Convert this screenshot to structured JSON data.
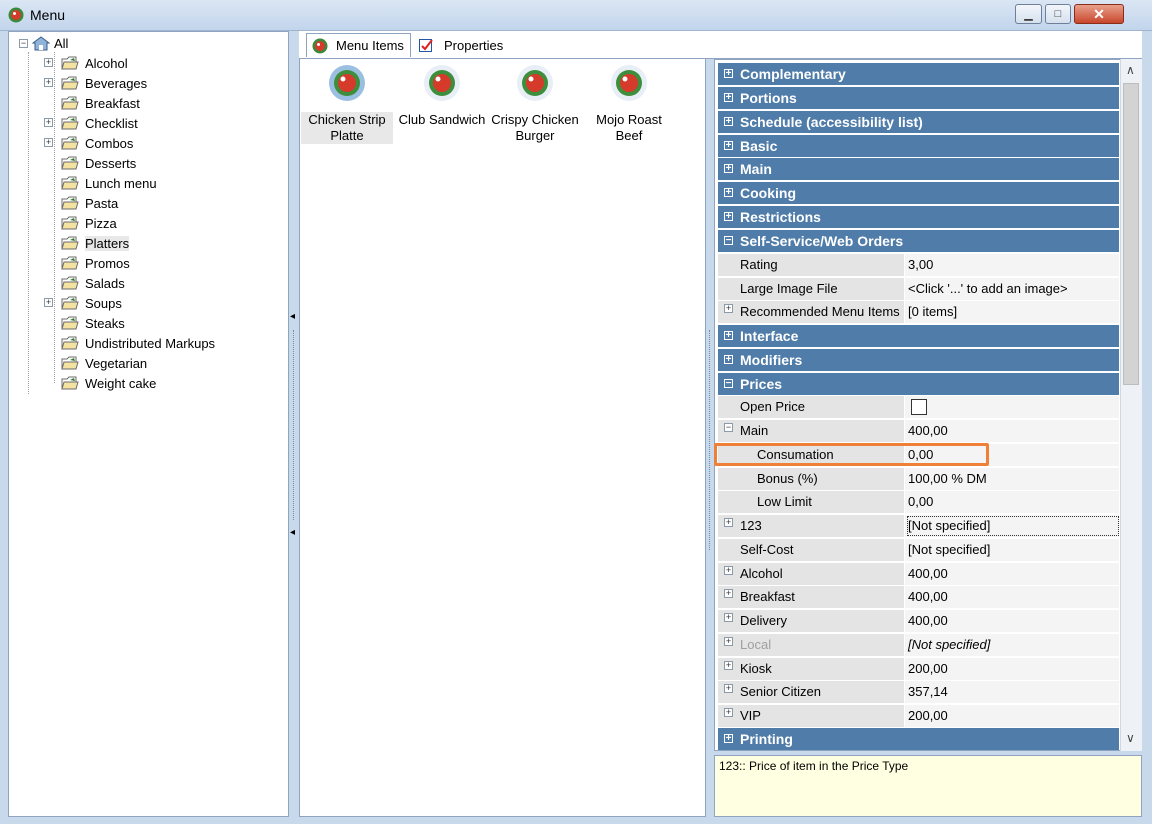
{
  "window": {
    "title": "Menu",
    "icon": "menu-app-icon",
    "controls": [
      "minimize",
      "maximize",
      "close"
    ]
  },
  "tree": {
    "root": "All",
    "items": [
      {
        "label": "Alcohol",
        "expandable": true
      },
      {
        "label": "Beverages",
        "expandable": true
      },
      {
        "label": "Breakfast",
        "expandable": false
      },
      {
        "label": "Checklist",
        "expandable": true
      },
      {
        "label": "Combos",
        "expandable": true
      },
      {
        "label": "Desserts",
        "expandable": false
      },
      {
        "label": "Lunch menu",
        "expandable": false
      },
      {
        "label": "Pasta",
        "expandable": false
      },
      {
        "label": "Pizza",
        "expandable": false
      },
      {
        "label": "Platters",
        "expandable": false,
        "selected": true
      },
      {
        "label": "Promos",
        "expandable": false
      },
      {
        "label": "Salads",
        "expandable": false
      },
      {
        "label": "Soups",
        "expandable": true
      },
      {
        "label": "Steaks",
        "expandable": false
      },
      {
        "label": "Undistributed Markups",
        "expandable": false
      },
      {
        "label": "Vegetarian",
        "expandable": false
      },
      {
        "label": "Weight cake",
        "expandable": false
      }
    ]
  },
  "tabs": [
    {
      "label": "Menu Items",
      "active": true
    },
    {
      "label": "Properties",
      "active": false
    }
  ],
  "menu_items": [
    {
      "line1": "Chicken Strip",
      "line2": "Platte",
      "selected": true
    },
    {
      "line1": "Club Sandwich",
      "line2": "",
      "selected": false
    },
    {
      "line1": "Crispy Chicken",
      "line2": "Burger",
      "selected": false
    },
    {
      "line1": "Mojo Roast",
      "line2": "Beef",
      "selected": false
    }
  ],
  "properties": {
    "cat_complementary": "Complementary",
    "cat_portions": "Portions",
    "cat_schedule": "Schedule (accessibility list)",
    "cat_basic": "Basic",
    "cat_main": "Main",
    "cat_cooking": "Cooking",
    "cat_restrictions": "Restrictions",
    "cat_selfservice": "Self-Service/Web Orders",
    "rating_name": "Rating",
    "rating_value": "3,00",
    "largeimg_name": "Large Image File",
    "largeimg_value": "<Click '...' to add an image>",
    "recommended_name": "Recommended Menu Items",
    "recommended_value": "[0 items]",
    "cat_interface": "Interface",
    "cat_modifiers": "Modifiers",
    "cat_prices": "Prices",
    "openprice_name": "Open Price",
    "main_name": "Main",
    "main_value": "400,00",
    "consumation_name": "Consumation",
    "consumation_value": "0,00",
    "bonus_name": "Bonus (%)",
    "bonus_value": "100,00 % DM",
    "lowlimit_name": "Low Limit",
    "lowlimit_value": "0,00",
    "p123_name": "123",
    "p123_value": "[Not specified]",
    "selfcost_name": "Self-Cost",
    "selfcost_value": "[Not specified]",
    "alcohol_name": "Alcohol",
    "alcohol_value": "400,00",
    "breakfast_name": "Breakfast",
    "breakfast_value": "400,00",
    "delivery_name": "Delivery",
    "delivery_value": "400,00",
    "local_name": "Local",
    "local_value": "[Not specified]",
    "kiosk_name": "Kiosk",
    "kiosk_value": "200,00",
    "senior_name": "Senior Citizen",
    "senior_value": "357,14",
    "vip_name": "VIP",
    "vip_value": "200,00",
    "cat_printing": "Printing"
  },
  "description": "123:: Price of item in the Price Type",
  "colors": {
    "category_bg": "#4f7ca8",
    "highlight": "#f08037",
    "description_bg": "#ffffe1"
  }
}
